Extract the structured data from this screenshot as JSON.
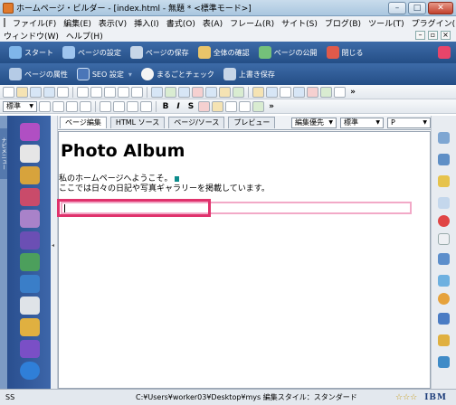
{
  "window": {
    "title": "ホームページ・ビルダー - [index.html - 無題 * <標準モード>]"
  },
  "menu": [
    "ファイル(F)",
    "編集(E)",
    "表示(V)",
    "挿入(I)",
    "書式(O)",
    "表(A)",
    "フレーム(R)",
    "サイト(S)",
    "ブログ(B)",
    "ツール(T)",
    "プラグイン(P)",
    "ウィンドウ(W)",
    "ヘルプ(H)"
  ],
  "quickbar1": [
    "スタート",
    "ページの設定",
    "ページの保存",
    "全体の確認",
    "ページの公開",
    "閉じる"
  ],
  "quickbar2": [
    "ページの属性",
    "SEO 設定",
    "まるごとチェック",
    "上書き保存"
  ],
  "format": {
    "style_select": "標準",
    "sans_label": "S"
  },
  "tabs": [
    "ページ編集",
    "HTML ソース",
    "ページ/ソース",
    "プレビュー"
  ],
  "tab_selects": [
    "編集優先",
    "標準",
    "P"
  ],
  "sidebar_label": "ナビメニュー",
  "document": {
    "heading": "Photo Album",
    "line1": "私のホームページへようこそ。",
    "line2": "ここでは日々の日記や写真ギャラリーを掲載しています。"
  },
  "status": {
    "mode": "SS",
    "path": "C:¥Users¥worker03¥Desktop¥mys 編集スタイル：スタンダード",
    "stars": "☆☆☆",
    "brand": "IBM"
  },
  "colors": {
    "highlight": "#e0326c",
    "field_border": "#f2a9c7",
    "bluebar": "#2f5b96"
  }
}
